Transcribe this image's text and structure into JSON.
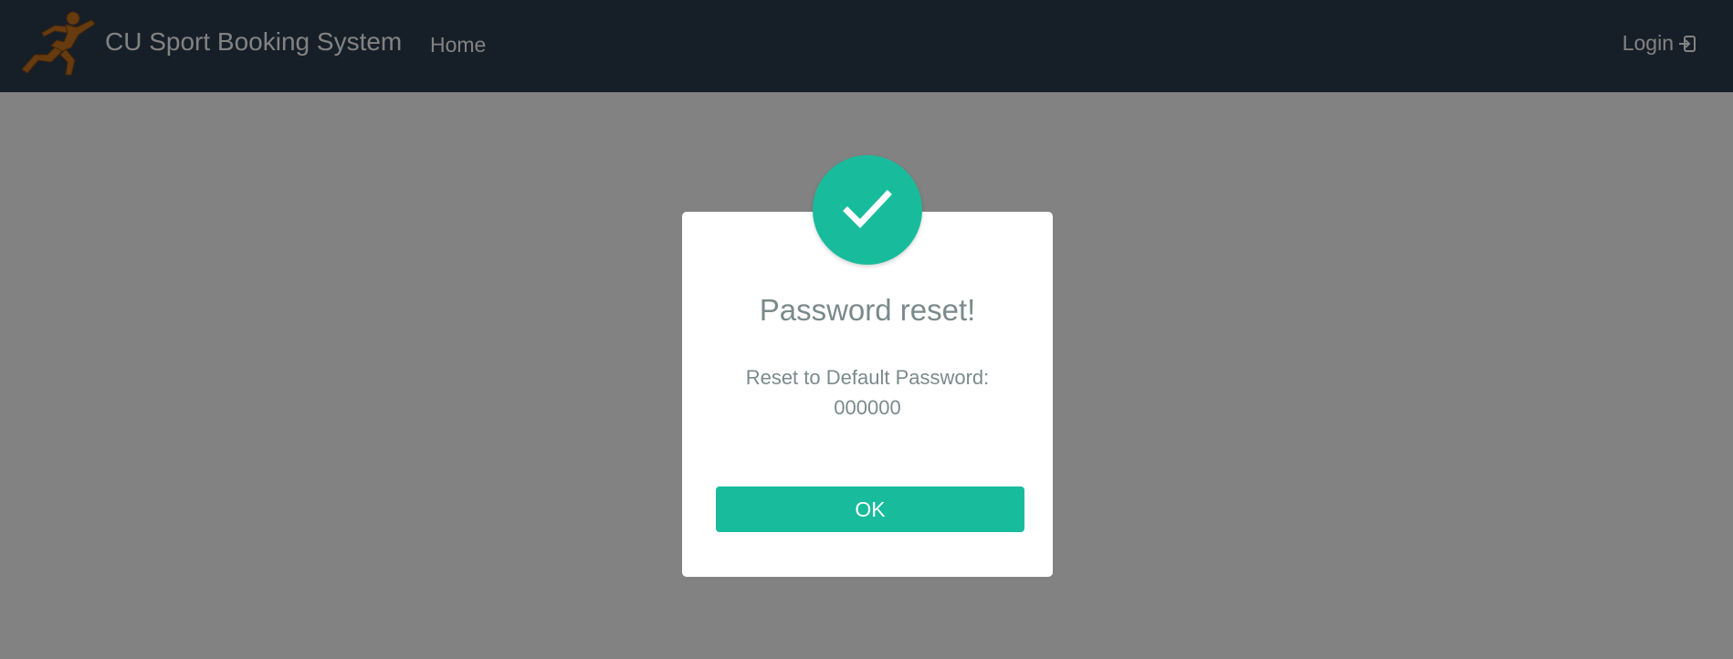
{
  "navbar": {
    "brand_title": "CU Sport Booking System",
    "home_label": "Home",
    "login_label": "Login",
    "logo_icon": "runner-logo",
    "login_icon": "sign-in-icon"
  },
  "dialog": {
    "icon": "checkmark-icon",
    "title": "Password reset!",
    "message_line1": "Reset to Default Password:",
    "message_line2": "000000",
    "ok_label": "OK"
  },
  "colors": {
    "navbar_bg": "#2c3e50",
    "accent": "#18bc9c",
    "text_muted": "#7b8a8b"
  }
}
